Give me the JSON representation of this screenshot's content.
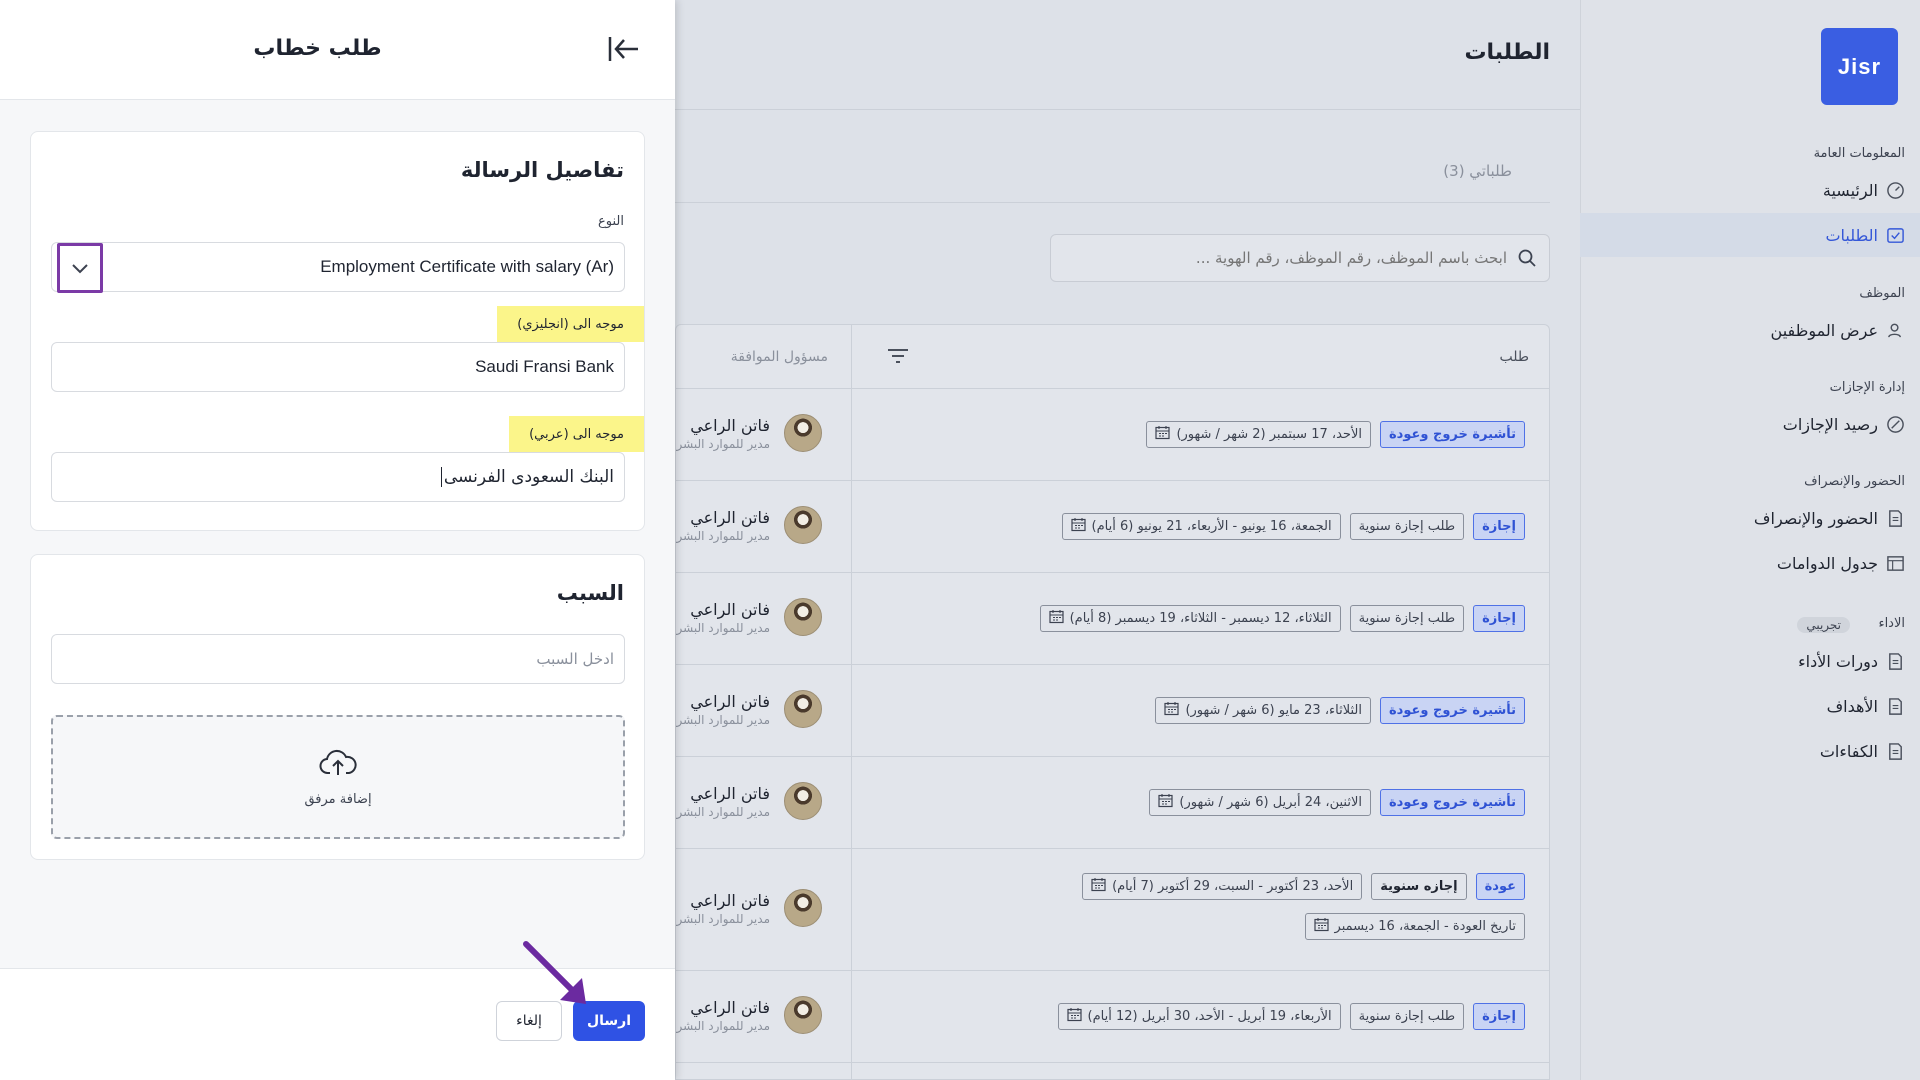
{
  "sidebar": {
    "logo": "Jisr",
    "sections": {
      "general": "المعلومات العامة",
      "employee": "الموظف",
      "leave": "إدارة الإجازات",
      "attendance": "الحضور والإنصراف",
      "performance": "الاداء",
      "trial_badge": "تجريبي"
    },
    "items": {
      "home": "الرئيسية",
      "requests": "الطلبات",
      "employees": "عرض الموظفين",
      "leave_balance": "رصيد الإجازات",
      "attendance": "الحضور والإنصراف",
      "shifts": "جدول الدوامات",
      "cycles": "دورات الأداء",
      "goals": "الأهداف",
      "competencies": "الكفاءات"
    },
    "accent": "#3558d8"
  },
  "main": {
    "title": "الطلبات",
    "my_requests_tab": "طلباتي (3)",
    "search_placeholder": "ابحث باسم الموظف، رقم الموظف، رقم الهوية ...",
    "table": {
      "col_request": "طلب",
      "col_approver": "مسؤول الموافقة",
      "rows": [
        {
          "type": "تأشيرة خروج وعودة",
          "subtype": "",
          "date": "الأحد، 17 سبتمبر (2 شهر / شهور)",
          "extra": "",
          "approver": "فاتن الراعي",
          "role": "مدير للموارد البشرية"
        },
        {
          "type": "إجازة",
          "subtype": "طلب إجازة سنوية",
          "date": "الجمعة، 16 يونيو - الأربعاء، 21 يونيو (6 أيام)",
          "extra": "",
          "approver": "فاتن الراعي",
          "role": "مدير للموارد البشرية"
        },
        {
          "type": "إجازة",
          "subtype": "طلب إجازة سنوية",
          "date": "الثلاثاء، 12 ديسمبر - الثلاثاء، 19 ديسمبر (8 أيام)",
          "extra": "",
          "approver": "فاتن الراعي",
          "role": "مدير للموارد البشرية"
        },
        {
          "type": "تأشيرة خروج وعودة",
          "subtype": "",
          "date": "الثلاثاء، 23 مايو (6 شهر / شهور)",
          "extra": "",
          "approver": "فاتن الراعي",
          "role": "مدير للموارد البشرية"
        },
        {
          "type": "تأشيرة خروج وعودة",
          "subtype": "",
          "date": "الاثنين، 24 أبريل (6 شهر / شهور)",
          "extra": "",
          "approver": "فاتن الراعي",
          "role": "مدير للموارد البشرية"
        },
        {
          "type": "عودة",
          "subtype": "إجازه سنوية",
          "date": "الأحد، 23 أكتوبر - السبت، 29 أكتوبر (7 أيام)",
          "extra": "تاريخ العودة - الجمعة، 16 ديسمبر",
          "approver": "فاتن الراعي",
          "role": "مدير للموارد البشرية"
        },
        {
          "type": "إجازة",
          "subtype": "طلب إجازة سنوية",
          "date": "الأربعاء، 19 أبريل - الأحد، 30 أبريل (12 أيام)",
          "extra": "",
          "approver": "فاتن الراعي",
          "role": "مدير للموارد البشرية"
        }
      ]
    }
  },
  "drawer": {
    "title": "طلب خطاب",
    "details_title": "تفاصيل الرسالة",
    "type_label": "النوع",
    "type_value": "Employment Certificate with salary (Ar)",
    "to_en_label": "موجه الى (انجليزي)",
    "to_en_value": "Saudi Fransi Bank",
    "to_ar_label": "موجه الى (عربي)",
    "to_ar_value": "البنك السعودى الفرنسى",
    "reason_title": "السبب",
    "reason_placeholder": "ادخل السبب",
    "attachment_label": "إضافة مرفق",
    "send_label": "ارسال",
    "cancel_label": "إلغاء"
  }
}
